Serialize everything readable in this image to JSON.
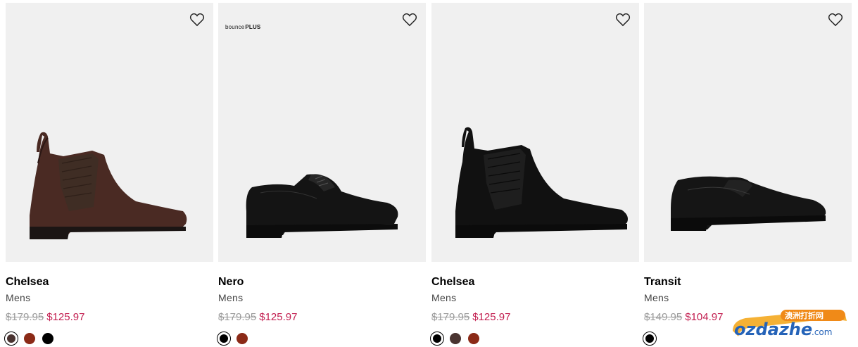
{
  "products": [
    {
      "name": "Chelsea",
      "gender": "Mens",
      "old_price": "$179.95",
      "price": "$125.97",
      "badge": "",
      "swatches": [
        "#4a3431",
        "#8b2a17",
        "#000000"
      ],
      "selected_swatch": 0
    },
    {
      "name": "Nero",
      "gender": "Mens",
      "old_price": "$179.95",
      "price": "$125.97",
      "badge_text": "bounce",
      "badge_bold": "PLUS",
      "swatches": [
        "#000000",
        "#8b2a17"
      ],
      "selected_swatch": 0
    },
    {
      "name": "Chelsea",
      "gender": "Mens",
      "old_price": "$179.95",
      "price": "$125.97",
      "badge": "",
      "swatches": [
        "#000000",
        "#4a3431",
        "#8b2a17"
      ],
      "selected_swatch": 0
    },
    {
      "name": "Transit",
      "gender": "Mens",
      "old_price": "$149.95",
      "price": "$104.97",
      "badge": "",
      "swatches": [
        "#000000"
      ],
      "selected_swatch": 0
    }
  ],
  "icons": {
    "wishlist": "heart-outline-icon"
  },
  "colors": {
    "sale": "#c21d4f",
    "old_price": "#9a9a9a",
    "tile_bg": "#f0f0f0"
  },
  "watermark": {
    "cn": "澳洲打折网",
    "brand": "ozdazhe",
    "tld": ".com"
  }
}
